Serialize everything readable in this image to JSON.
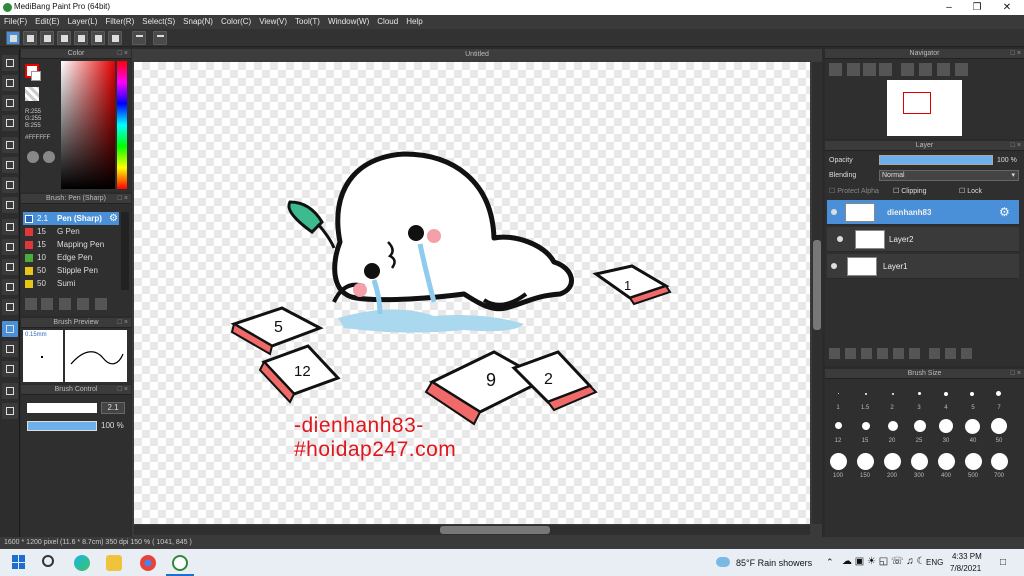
{
  "window": {
    "title": "MediBang Paint Pro (64bit)"
  },
  "menu": [
    "File(F)",
    "Edit(E)",
    "Layer(L)",
    "Filter(R)",
    "Select(S)",
    "Snap(N)",
    "Color(C)",
    "View(V)",
    "Tool(T)",
    "Window(W)",
    "Cloud",
    "Help"
  ],
  "color_panel": {
    "title": "Color",
    "r": "R:255",
    "g": "G:255",
    "b": "B:255",
    "hex": "#FFFFFF"
  },
  "brush_panel": {
    "title": "Brush: Pen (Sharp)",
    "items": [
      {
        "size": "2.1",
        "name": "Pen (Sharp)",
        "color": "#2a63b8"
      },
      {
        "size": "15",
        "name": "G Pen",
        "color": "#e0383a"
      },
      {
        "size": "15",
        "name": "Mapping Pen",
        "color": "#e0383a"
      },
      {
        "size": "10",
        "name": "Edge Pen",
        "color": "#4cab3c"
      },
      {
        "size": "50",
        "name": "Stipple Pen",
        "color": "#e8c619"
      },
      {
        "size": "50",
        "name": "Sumi",
        "color": "#e8c619"
      }
    ]
  },
  "preview_panel": {
    "title": "Brush Preview",
    "size": "0.15mm"
  },
  "control_panel": {
    "title": "Brush Control",
    "size_value": "2.1",
    "opacity_value": "100 %"
  },
  "canvas": {
    "tab": "Untitled",
    "watermark_line1": "-dienhanh83-",
    "watermark_line2": "#hoidap247.com",
    "cards": [
      "5",
      "12",
      "9",
      "2",
      "1"
    ]
  },
  "navigator": {
    "title": "Navigator"
  },
  "layer_panel": {
    "title": "Layer",
    "opacity_label": "Opacity",
    "opacity_value": "100 %",
    "blending_label": "Blending",
    "blending_value": "Normal",
    "protect_alpha": "Protect Alpha",
    "clipping": "Clipping",
    "lock": "Lock",
    "layers": [
      {
        "name": "dienhanh83"
      },
      {
        "name": "Layer2"
      },
      {
        "name": "Layer1"
      }
    ]
  },
  "size_panel": {
    "title": "Brush Size",
    "row1": [
      "1",
      "1.5",
      "2",
      "3",
      "4",
      "5",
      "7"
    ],
    "row2": [
      "12",
      "15",
      "20",
      "25",
      "30",
      "40",
      "50"
    ],
    "row3": [
      "100",
      "150",
      "200",
      "300",
      "400",
      "500",
      "700"
    ]
  },
  "status": {
    "text": "1600 * 1200 pixel   (11.6 * 8.7cm)   350 dpi   150 %   ( 1041, 845 )"
  },
  "taskbar": {
    "weather": "85°F  Rain showers",
    "lang": "ENG",
    "time": "4:33 PM",
    "date": "7/8/2021"
  },
  "colors": {
    "accent": "#4a90d9",
    "panel": "#2f2f2f",
    "watermark": "#e0161c"
  }
}
